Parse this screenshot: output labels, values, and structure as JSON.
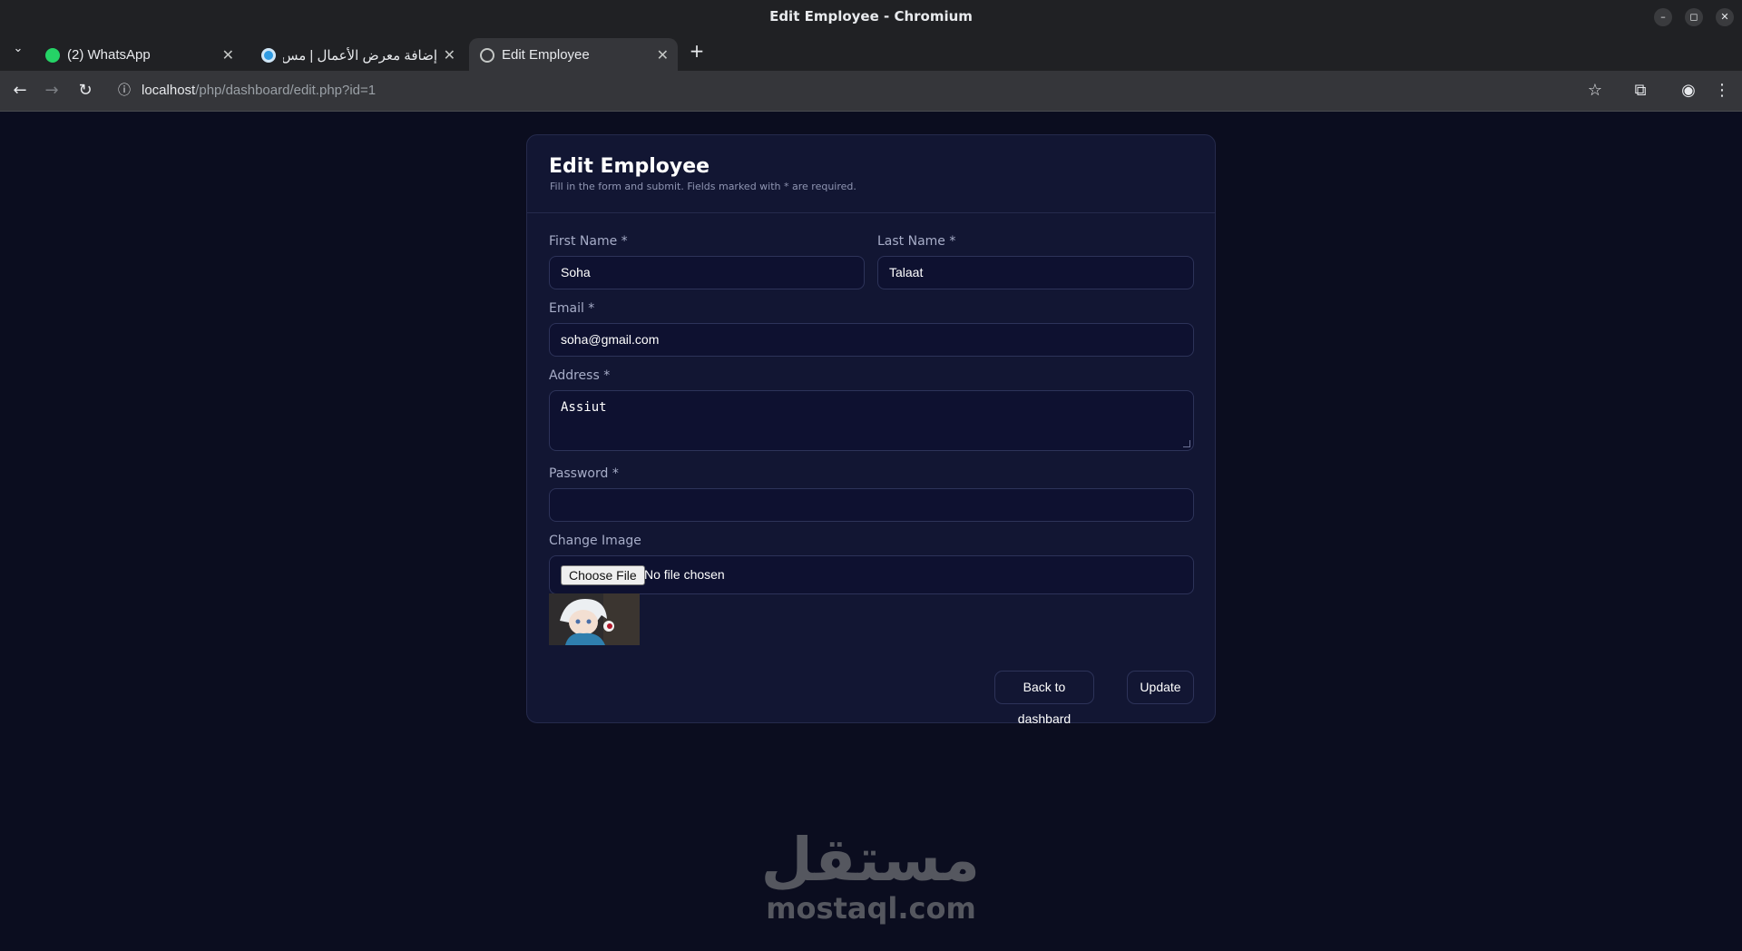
{
  "window": {
    "title": "Edit Employee - Chromium"
  },
  "tabs": [
    {
      "title": "(2) WhatsApp",
      "icon": "whatsapp-icon"
    },
    {
      "title": "إضافة معرض الأعمال | مس...",
      "icon": "mostaql-icon"
    },
    {
      "title": "Edit Employee",
      "icon": "globe-icon"
    }
  ],
  "address_bar": {
    "host": "localhost",
    "path": "/php/dashboard/edit.php?id=1"
  },
  "form": {
    "title": "Edit Employee",
    "subtitle": "Fill in the form and submit. Fields marked with * are required.",
    "first_name": {
      "label": "First Name *",
      "value": "Soha"
    },
    "last_name": {
      "label": "Last Name *",
      "value": "Talaat"
    },
    "email": {
      "label": "Email *",
      "value": "soha@gmail.com"
    },
    "address": {
      "label": "Address *",
      "value": "Assiut"
    },
    "password": {
      "label": "Password *",
      "value": ""
    },
    "image": {
      "label": "Change Image",
      "button": "Choose File",
      "status": "No file chosen"
    },
    "back_button": "Back to dashbard",
    "update_button": "Update"
  },
  "watermark": {
    "arabic": "مستقل",
    "latin": "mostaql.com"
  },
  "colors": {
    "page_bg": "#0b0d1f",
    "card_bg": "#121633",
    "border": "#2d3359",
    "whatsapp": "#25d366",
    "mostaql": "#2f9be3"
  }
}
